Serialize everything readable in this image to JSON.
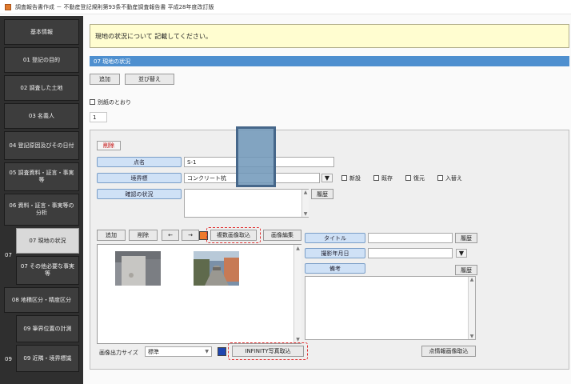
{
  "window": {
    "title": "調査報告書作成 － 不動産登記規則第93条不動産調査報告書 平成28年度改訂版"
  },
  "sidebar": {
    "items": [
      {
        "label": "基本情報"
      },
      {
        "label": "01 登記の目的"
      },
      {
        "label": "02 調査した土地"
      },
      {
        "label": "03 名義人"
      },
      {
        "label": "04 登記原因及びその日付"
      },
      {
        "label": "05 調査資料・証言・事実等"
      },
      {
        "label": "06 資料・証言・事実等の分析"
      },
      {
        "label": "07 現地の状況"
      },
      {
        "label": "07 その他必要な事実等"
      },
      {
        "label": "08 地積区分・精度区分"
      },
      {
        "label": "09 筆界位置の計測"
      },
      {
        "label": "09 近隣・境界標識"
      }
    ],
    "group_labels": {
      "g07": "07",
      "g09": "09"
    }
  },
  "instruction": "現地の状況について 記載してください。",
  "section": {
    "title": "07 現地の状況",
    "add_label": "追加",
    "sort_label": "並び替え",
    "checkbox_label": "別紙のとおり",
    "page_value": "1"
  },
  "form": {
    "delete_label": "削除",
    "point_name_label": "点名",
    "point_name_value": "S-1",
    "boundary_label": "境界標",
    "boundary_value": "コンクリート杭",
    "options": [
      "新設",
      "既存",
      "復元",
      "入替え"
    ],
    "confirm_label": "確認の状況",
    "history_label": "履歴"
  },
  "photos": {
    "add_label": "追加",
    "delete_label": "削除",
    "prev_label": "←",
    "next_label": "→",
    "multi_import_label": "複数画像取込",
    "edit_label": "画像編集",
    "output_size_label": "画像出力サイズ",
    "output_size_value": "標準",
    "infinity_label": "INFINITY写真取込",
    "thumbnails": [
      "photo-1",
      "photo-2"
    ],
    "swatch_colors": {
      "orange": "#ee7a2a",
      "blue": "#1f46b0"
    }
  },
  "detail": {
    "title_label": "タイトル",
    "title_history": "履歴",
    "date_label": "撮影年月日",
    "note_label": "備考",
    "note_history": "履歴",
    "point_import_label": "点情報画像取込"
  }
}
